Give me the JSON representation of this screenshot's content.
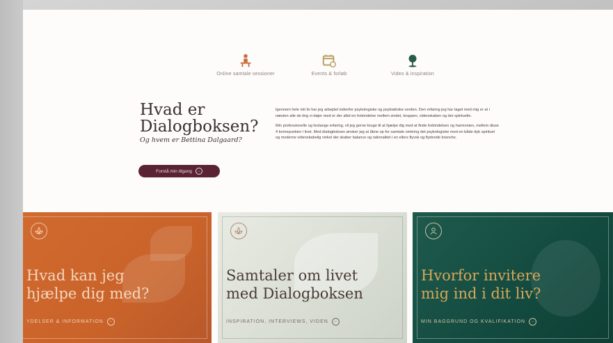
{
  "features": [
    {
      "label": "Online samtale sessioner",
      "icon": "consultation-icon",
      "color": "#c96a36"
    },
    {
      "label": "Events & forløb",
      "icon": "calendar-icon",
      "color": "#b79a5a"
    },
    {
      "label": "Video & inspiration",
      "icon": "tree-icon",
      "color": "#2a5a4a"
    }
  ],
  "intro": {
    "title_line1": "Hvad er",
    "title_line2": "Dialogboksen?",
    "subtitle": "Og hvem er Bettina Dalgaard?",
    "button_label": "Forstå min tilgang",
    "paragraph1": "Igennem hele mit liv har jeg arbejdet indenfor psykologiske og psykiatriske verden. Den erfaring jeg har taget med mig er at i næsten alle de ting vi døjer med er der altid en forbindelse mellem sindet, kroppen, videnskaben og det spirituelle.",
    "paragraph2": "Min professionelle og livslange erfaring, vil jeg gerne bruge til at hjælpe dig med at finde forbindelsen og harmonien, mellem disse 4 kernepunkter i livet. Med dialogboksen ønsker jeg at åbne op for samtale omkring det psykologiske med en både dyb spirituel og moderne videnskabelig vinkel der skaber balance og rationalitet i en ellers flyvsk og flydende branche."
  },
  "cards": [
    {
      "title_line1": "Hvad kan jeg",
      "title_line2": "hjælpe dig med?",
      "cta": "YDELSER & INFORMATION",
      "icon": "lotus-icon",
      "color": "#c9632a"
    },
    {
      "title_line1": "Samtaler om livet",
      "title_line2": "med Dialogboksen",
      "cta": "INSPIRATION, INTERVIEWS, VIDEN",
      "icon": "lotus-icon",
      "color": "#dde1d8"
    },
    {
      "title_line1": "Hvorfor invitere",
      "title_line2": "mig ind i dit liv?",
      "cta": "MIN BAGGRUND OG KVALIFIKATION",
      "icon": "profile-icon",
      "color": "#134a3f"
    }
  ]
}
